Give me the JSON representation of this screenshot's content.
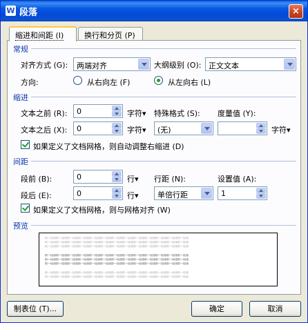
{
  "window": {
    "title": "段落",
    "app_icon": "W",
    "close_glyph": "×"
  },
  "tabs": [
    {
      "label": "缩进和间距 (I)"
    },
    {
      "label": "换行和分页 (P)"
    }
  ],
  "general": {
    "section": "常规",
    "align_label": "对齐方式 (G):",
    "align_value": "两端对齐",
    "outline_label": "大纲级别 (O):",
    "outline_value": "正文文本",
    "direction_label": "方向:",
    "rtl_label": "从右向左 (F)",
    "ltr_label": "从左向右 (L)"
  },
  "indent": {
    "section": "缩进",
    "before_label": "文本之前 (R):",
    "before_value": "0",
    "before_unit": "字符▾",
    "special_label": "特殊格式 (S):",
    "special_value": "(无)",
    "measure_label": "度量值 (Y):",
    "measure_value": "",
    "measure_unit": "字符▾",
    "after_label": "文本之后 (X):",
    "after_value": "0",
    "after_unit": "字符▾",
    "grid_label": "如果定义了文档网格，则自动调整右缩进 (D)"
  },
  "spacing": {
    "section": "间距",
    "before_label": "段前 (B):",
    "before_value": "0",
    "before_unit": "行▾",
    "line_label": "行距 (N):",
    "line_value": "单倍行距",
    "setting_label": "设置值 (A):",
    "setting_value": "1",
    "after_label": "段后 (E):",
    "after_value": "0",
    "after_unit": "行▾",
    "snap_label": "如果定义了文档网格，则与网格对齐 (W)"
  },
  "preview": {
    "section": "预览",
    "text": "前一段落前一段落前一段落前一段落前一段落前一段落前一段落前一段落前一段落前一段落前一段落前一段落前一段落"
  },
  "footer": {
    "tabs_button": "制表位 (T)...",
    "ok_button": "确定",
    "cancel_button": "取消"
  },
  "colors": {
    "title_bar": "#0858e0",
    "section_text": "#0a36b0",
    "dialog_bg": "#ece9d8"
  }
}
